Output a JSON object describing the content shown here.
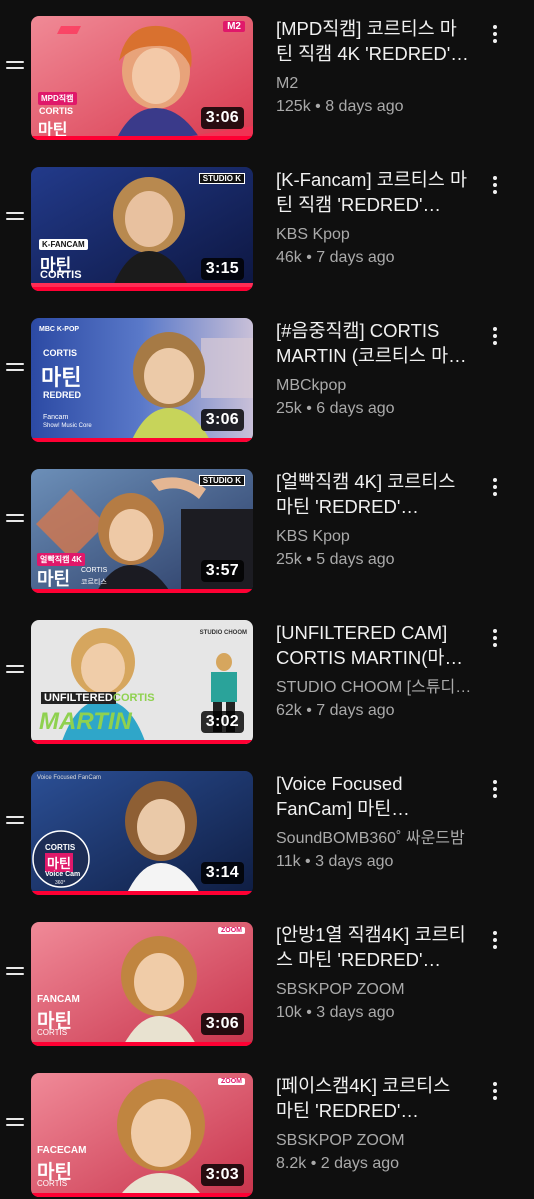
{
  "playlist": {
    "items": [
      {
        "title": "[MPD직캠] 코르티스 마틴 직캠 4K 'REDRED' (CORTIS MARTIN FanCam)",
        "channel": "M2",
        "views": "125k",
        "age": "8 days ago",
        "duration": "3:06",
        "thumbnail": {
          "bg": "#e85a6a",
          "overlay_lines": [
            "MPD직캠",
            "CORTIS",
            "마틴"
          ],
          "logo": "M2",
          "accent": "#ff2d55"
        }
      },
      {
        "title": "[K-Fancam] 코르티스 마틴 직캠 'REDRED' (CORTIS MARTIN Fancam)",
        "channel": "KBS Kpop",
        "views": "46k",
        "age": "7 days ago",
        "duration": "3:15",
        "thumbnail": {
          "bg": "#1b2a6b",
          "overlay_lines": [
            "K-FANCAM",
            "마틴",
            "CORTIS"
          ],
          "logo": "STUDIO K",
          "accent": "#ff2d55"
        }
      },
      {
        "title": "[#음중직캠] CORTIS MARTIN (코르티스 마틴) - REDRED FanCam",
        "channel": "MBCkpop",
        "views": "25k",
        "age": "6 days ago",
        "duration": "3:06",
        "thumbnail": {
          "bg": "#2f4ea8",
          "overlay_lines": [
            "MBC K-POP",
            "CORTIS",
            "마틴",
            "REDRED",
            "Fancam",
            "Show! Music Core"
          ],
          "logo": "",
          "accent": "#ffffff"
        }
      },
      {
        "title": "[얼빡직캠 4K] 코르티스 마틴 'REDRED' (CORTIS MARTIN Facecam)",
        "channel": "KBS Kpop",
        "views": "25k",
        "age": "5 days ago",
        "duration": "3:57",
        "thumbnail": {
          "bg": "#3a5b8c",
          "overlay_lines": [
            "얼빡직캠 4K",
            "마틴",
            "CORTIS",
            "코르티스"
          ],
          "logo": "STUDIO K",
          "accent": "#ff2d55"
        }
      },
      {
        "title": "[UNFILTERED CAM] CORTIS MARTIN(마틴) 'REDRED'",
        "channel": "STUDIO CHOOM [스튜디오 춤]",
        "views": "62k",
        "age": "7 days ago",
        "duration": "3:02",
        "thumbnail": {
          "bg": "#dcdcdc",
          "overlay_lines": [
            "UNFILTERED",
            "CORTIS",
            "MARTIN"
          ],
          "logo": "STUDIO CHOOM",
          "accent": "#8fd14f"
        }
      },
      {
        "title": "[Voice Focused FanCam] 마틴 (CORTIS MARTIN) - REDRED",
        "channel": "SoundBOMB360˚ 싸운드밤",
        "views": "11k",
        "age": "3 days ago",
        "duration": "3:14",
        "thumbnail": {
          "bg": "#1f3b73",
          "overlay_lines": [
            "Voice Focused FanCam",
            "CORTIS",
            "마틴",
            "Voice Cam",
            "360°"
          ],
          "logo": "",
          "accent": "#ff2d55"
        }
      },
      {
        "title": "[안방1열 직캠4K] 코르티스 마틴 'REDRED' (CORTIS MARTIN FanCam)",
        "channel": "SBSKPOP ZOOM",
        "views": "10k",
        "age": "3 days ago",
        "duration": "3:06",
        "thumbnail": {
          "bg": "#d9556a",
          "overlay_lines": [
            "FANCAM",
            "마틴",
            "CORTIS"
          ],
          "logo": "ZOOM",
          "accent": "#ff2d55"
        }
      },
      {
        "title": "[페이스캠4K] 코르티스 마틴 'REDRED' (CORTIS MARTIN FaceCam)",
        "channel": "SBSKPOP ZOOM",
        "views": "8.2k",
        "age": "2 days ago",
        "duration": "3:03",
        "thumbnail": {
          "bg": "#d9556a",
          "overlay_lines": [
            "FACECAM",
            "마틴",
            "CORTIS"
          ],
          "logo": "ZOOM",
          "accent": "#ff2d55"
        }
      }
    ]
  },
  "icons": {
    "drag": "drag-handle-icon",
    "more": "more-vert-icon"
  },
  "colors": {
    "background": "#0f0f0f",
    "title_text": "#f1f1f1",
    "secondary_text": "#aaaaaa",
    "progress_red": "#ff0033"
  }
}
